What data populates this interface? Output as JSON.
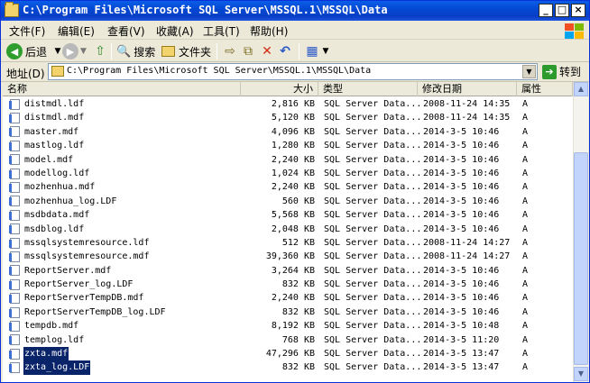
{
  "window": {
    "title": "C:\\Program Files\\Microsoft SQL Server\\MSSQL.1\\MSSQL\\Data"
  },
  "menu": {
    "items": [
      "文件(F)",
      "编辑(E)",
      "查看(V)",
      "收藏(A)",
      "工具(T)",
      "帮助(H)"
    ]
  },
  "toolbar": {
    "back_label": "后退",
    "search_label": "搜索",
    "folders_label": "文件夹"
  },
  "address": {
    "label": "地址(D)",
    "value": "C:\\Program Files\\Microsoft SQL Server\\MSSQL.1\\MSSQL\\Data",
    "go_label": "转到"
  },
  "columns": {
    "name": "名称",
    "size": "大小",
    "type": "类型",
    "modified": "修改日期",
    "attributes": "属性"
  },
  "files": [
    {
      "name": "distmdl.ldf",
      "size": "2,816 KB",
      "type": "SQL Server Data...",
      "modified": "2008-11-24 14:35",
      "attr": "A"
    },
    {
      "name": "distmdl.mdf",
      "size": "5,120 KB",
      "type": "SQL Server Data...",
      "modified": "2008-11-24 14:35",
      "attr": "A"
    },
    {
      "name": "master.mdf",
      "size": "4,096 KB",
      "type": "SQL Server Data...",
      "modified": "2014-3-5 10:46",
      "attr": "A"
    },
    {
      "name": "mastlog.ldf",
      "size": "1,280 KB",
      "type": "SQL Server Data...",
      "modified": "2014-3-5 10:46",
      "attr": "A"
    },
    {
      "name": "model.mdf",
      "size": "2,240 KB",
      "type": "SQL Server Data...",
      "modified": "2014-3-5 10:46",
      "attr": "A"
    },
    {
      "name": "modellog.ldf",
      "size": "1,024 KB",
      "type": "SQL Server Data...",
      "modified": "2014-3-5 10:46",
      "attr": "A"
    },
    {
      "name": "mozhenhua.mdf",
      "size": "2,240 KB",
      "type": "SQL Server Data...",
      "modified": "2014-3-5 10:46",
      "attr": "A"
    },
    {
      "name": "mozhenhua_log.LDF",
      "size": "560 KB",
      "type": "SQL Server Data...",
      "modified": "2014-3-5 10:46",
      "attr": "A"
    },
    {
      "name": "msdbdata.mdf",
      "size": "5,568 KB",
      "type": "SQL Server Data...",
      "modified": "2014-3-5 10:46",
      "attr": "A"
    },
    {
      "name": "msdblog.ldf",
      "size": "2,048 KB",
      "type": "SQL Server Data...",
      "modified": "2014-3-5 10:46",
      "attr": "A"
    },
    {
      "name": "mssqlsystemresource.ldf",
      "size": "512 KB",
      "type": "SQL Server Data...",
      "modified": "2008-11-24 14:27",
      "attr": "A"
    },
    {
      "name": "mssqlsystemresource.mdf",
      "size": "39,360 KB",
      "type": "SQL Server Data...",
      "modified": "2008-11-24 14:27",
      "attr": "A"
    },
    {
      "name": "ReportServer.mdf",
      "size": "3,264 KB",
      "type": "SQL Server Data...",
      "modified": "2014-3-5 10:46",
      "attr": "A"
    },
    {
      "name": "ReportServer_log.LDF",
      "size": "832 KB",
      "type": "SQL Server Data...",
      "modified": "2014-3-5 10:46",
      "attr": "A"
    },
    {
      "name": "ReportServerTempDB.mdf",
      "size": "2,240 KB",
      "type": "SQL Server Data...",
      "modified": "2014-3-5 10:46",
      "attr": "A"
    },
    {
      "name": "ReportServerTempDB_log.LDF",
      "size": "832 KB",
      "type": "SQL Server Data...",
      "modified": "2014-3-5 10:46",
      "attr": "A"
    },
    {
      "name": "tempdb.mdf",
      "size": "8,192 KB",
      "type": "SQL Server Data...",
      "modified": "2014-3-5 10:48",
      "attr": "A"
    },
    {
      "name": "templog.ldf",
      "size": "768 KB",
      "type": "SQL Server Data...",
      "modified": "2014-3-5 11:20",
      "attr": "A"
    },
    {
      "name": "zxta.mdf",
      "size": "47,296 KB",
      "type": "SQL Server Data...",
      "modified": "2014-3-5 13:47",
      "attr": "A",
      "selected": true
    },
    {
      "name": "zxta_log.LDF",
      "size": "832 KB",
      "type": "SQL Server Data...",
      "modified": "2014-3-5 13:47",
      "attr": "A",
      "selected": true
    }
  ],
  "colors": {
    "titlebar": "#0a5de8",
    "selection": "#0a246a"
  }
}
